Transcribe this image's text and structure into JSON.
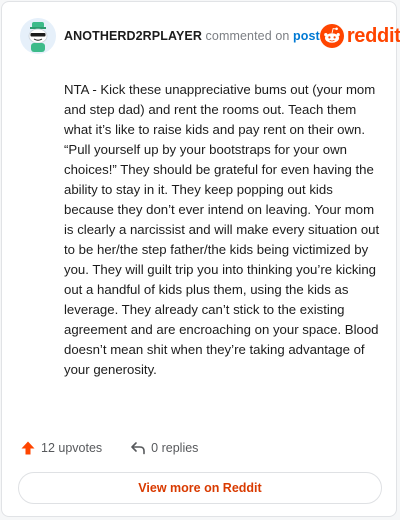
{
  "comment": {
    "username": "ANOTHERD2RPLAYER",
    "action_text": "commented on",
    "post_link": "post",
    "body": "NTA - Kick these unappreciative bums out (your mom and step dad) and rent the rooms out. Teach them what it’s like to raise kids and pay rent on their own. “Pull yourself up by your bootstraps for your own choices!” They should be grateful for even having the ability to stay in it. They keep popping out kids because they don’t ever intend on leaving. Your mom is clearly a narcissist and will make every situation out to be her/the step father/the kids being victimized by you. They will guilt trip you into thinking you’re kicking out a handful of kids plus them, using the kids as leverage. They already can’t stick to the existing agreement and are encroaching on your space. Blood doesn’t mean shit when they’re taking advantage of your generosity.",
    "upvotes": "12 upvotes",
    "replies": "0 replies"
  },
  "brand": {
    "name": "reddit",
    "icon": "reddit-logo-icon",
    "color": "#ff4500"
  },
  "footer": {
    "view_more_label": "View more on Reddit"
  },
  "icons": {
    "upvote": "upvote-arrow-icon",
    "reply": "reply-arrow-icon",
    "avatar": "snoo-avatar"
  },
  "colors": {
    "accent": "#ff4500",
    "link": "#0079d3",
    "view_more": "#d93a00"
  }
}
